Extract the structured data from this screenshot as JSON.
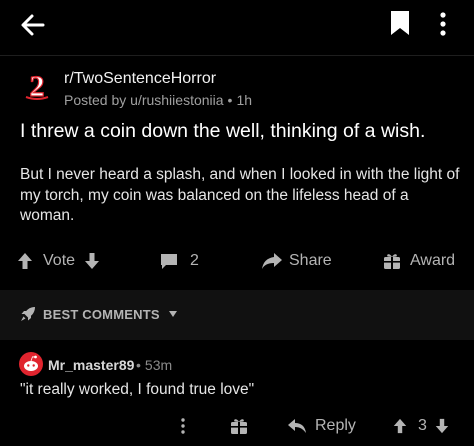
{
  "topbar": {
    "back_icon": "arrow-left-icon",
    "bookmark_icon": "bookmark-icon",
    "more_icon": "vertical-ellipsis-icon"
  },
  "post": {
    "avatar_text": "2",
    "subreddit": "r/TwoSentenceHorror",
    "posted_by": "Posted by u/rushiiestoniia",
    "separator": "•",
    "age": "1h",
    "title": "I threw a coin down the well, thinking of a wish.",
    "body": "But I never heard a splash, and when I looked in with the light of my torch, my coin was balanced on the lifeless head of a woman.",
    "actions": {
      "vote_label": "Vote",
      "comment_count": "2",
      "share_label": "Share",
      "award_label": "Award"
    }
  },
  "comments_section": {
    "sort_label": "BEST COMMENTS",
    "sort_icon": "rocket-icon"
  },
  "comments": [
    {
      "author": "Mr_master89",
      "separator": "•",
      "age": "53m",
      "text": "\"it really worked, I found true love\"",
      "reply_label": "Reply",
      "score": "3"
    }
  ],
  "colors": {
    "background": "#000000",
    "section_bar": "#111111",
    "avatar_red": "#e0242e",
    "muted_text": "#b4b4b4"
  }
}
